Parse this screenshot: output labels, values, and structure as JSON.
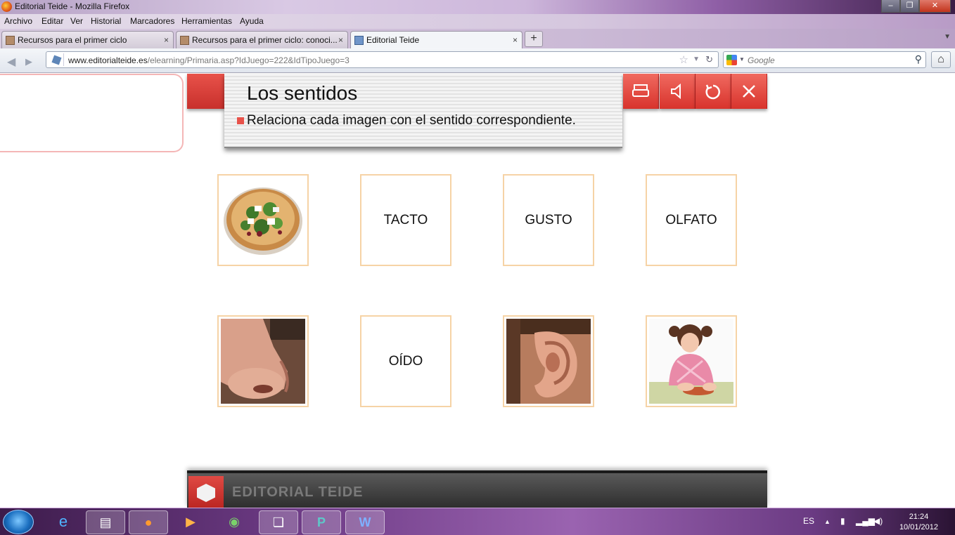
{
  "window": {
    "title": "Editorial Teide - Mozilla Firefox",
    "buttons": {
      "minimize": "–",
      "maximize": "❐",
      "close": "✕"
    }
  },
  "menu": [
    "Archivo",
    "Editar",
    "Ver",
    "Historial",
    "Marcadores",
    "Herramientas",
    "Ayuda"
  ],
  "tabs": [
    {
      "label": "Recursos para el primer ciclo",
      "active": false
    },
    {
      "label": "Recursos para el primer ciclo: conoci...",
      "active": false
    },
    {
      "label": "Editorial Teide",
      "active": true
    }
  ],
  "tab_close": "×",
  "new_tab": "+",
  "nav": {
    "url_domain": "www.editorialteide.es",
    "url_path": "/elearning/Primaria.asp?IdJuego=222&IdTipoJuego=3",
    "search_placeholder": "Google"
  },
  "page": {
    "title": "Los sentidos",
    "instruction": "Relaciona cada imagen con el sentido correspondiente.",
    "tools": [
      {
        "name": "print-button",
        "icon": "printer-icon",
        "glyph": "⎙"
      },
      {
        "name": "sound-button",
        "icon": "speaker-icon",
        "glyph": "◁"
      },
      {
        "name": "restart-button",
        "icon": "restart-icon",
        "glyph": "↻"
      },
      {
        "name": "close-game-button",
        "icon": "close-icon",
        "glyph": "✕"
      }
    ],
    "cards_row1": [
      {
        "type": "image",
        "image": "salad-plate"
      },
      {
        "type": "text",
        "label": "TACTO"
      },
      {
        "type": "text",
        "label": "GUSTO"
      },
      {
        "type": "text",
        "label": "OLFATO"
      }
    ],
    "cards_row2": [
      {
        "type": "image",
        "image": "nose"
      },
      {
        "type": "text",
        "label": "OÍDO"
      },
      {
        "type": "image",
        "image": "ear"
      },
      {
        "type": "image",
        "image": "girl-playdough"
      }
    ],
    "footer_brand": "EDITORIAL TEIDE"
  },
  "taskbar": {
    "language": "ES",
    "time": "21:24",
    "date": "10/01/2012"
  },
  "colors": {
    "accent_red": "#e8524a",
    "card_border": "#f6d3a6",
    "taskbar": "#6c3a84"
  }
}
